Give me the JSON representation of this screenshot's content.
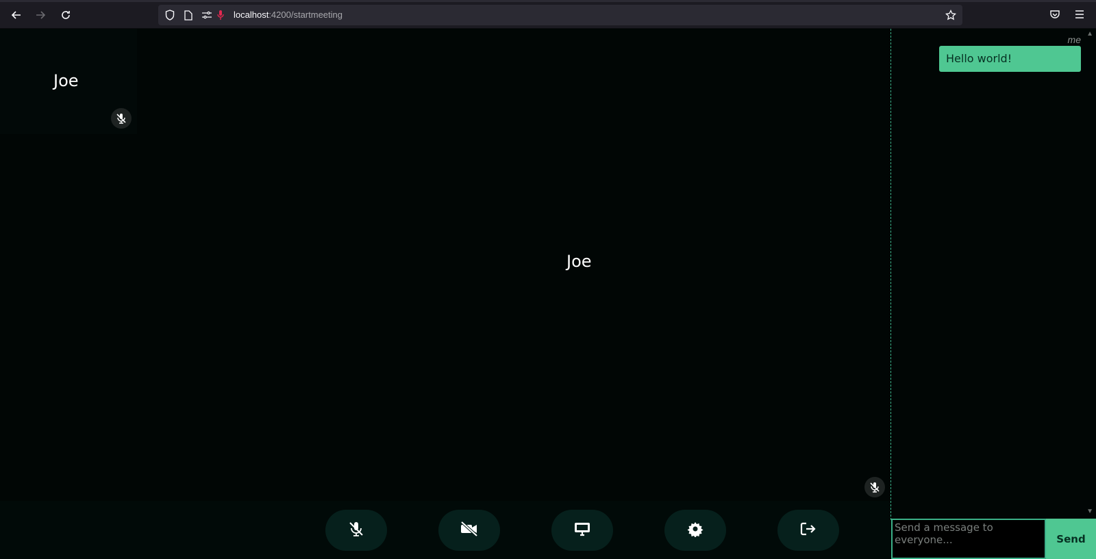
{
  "browser": {
    "url_host": "localhost",
    "url_path": ":4200/startmeeting",
    "icons": [
      "back-arrow-icon",
      "forward-arrow-icon",
      "reload-icon",
      "shield-icon",
      "page-icon",
      "permissions-icon",
      "microphone-icon",
      "star-icon",
      "pocket-icon",
      "menu-icon"
    ]
  },
  "meeting": {
    "thumbnail_name": "Joe",
    "main_name": "Joe",
    "controls": [
      {
        "icon": "mic-off-icon"
      },
      {
        "icon": "video-off-icon"
      },
      {
        "icon": "screen-share-icon"
      },
      {
        "icon": "settings-icon"
      },
      {
        "icon": "leave-icon"
      }
    ]
  },
  "chat": {
    "messages": [
      {
        "sender": "me",
        "text": "Hello world!"
      }
    ],
    "input_placeholder": "Send a message to everyone...",
    "send_label": "Send"
  },
  "colors": {
    "accent": "#4fc792",
    "background": "#010605",
    "control_bg": "#06201c"
  }
}
